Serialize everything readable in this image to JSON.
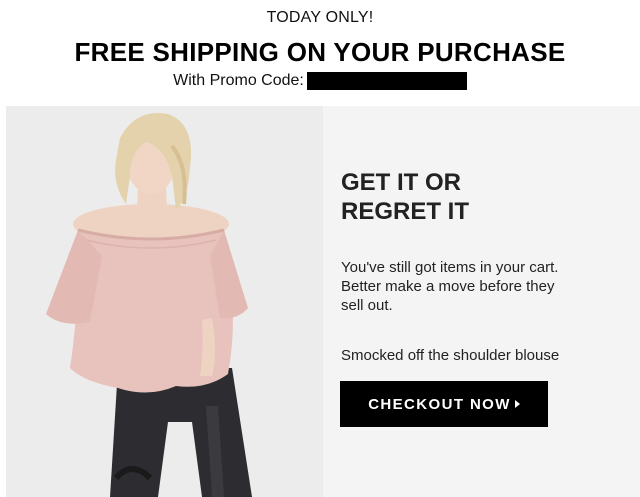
{
  "banner": {
    "kicker": "TODAY ONLY!",
    "headline": "FREE SHIPPING ON YOUR PURCHASE",
    "promo_label": "With Promo Code:"
  },
  "hero": {
    "title": "GET IT OR\nREGRET IT",
    "body": "You've still got items in your cart. Better make a move before they sell out.",
    "product_name": "Smocked off the shoulder blouse",
    "cta_label": "CHECKOUT NOW"
  },
  "colors": {
    "background": "#ffffff",
    "photo_bg": "#ececec",
    "panel_bg": "#f4f4f4",
    "blouse_pink": "#e8c3bd",
    "jeans": "#2d2d31",
    "button": "#000000",
    "button_text": "#ffffff"
  },
  "icons": {
    "cta_arrow": "triangle-right-icon"
  }
}
